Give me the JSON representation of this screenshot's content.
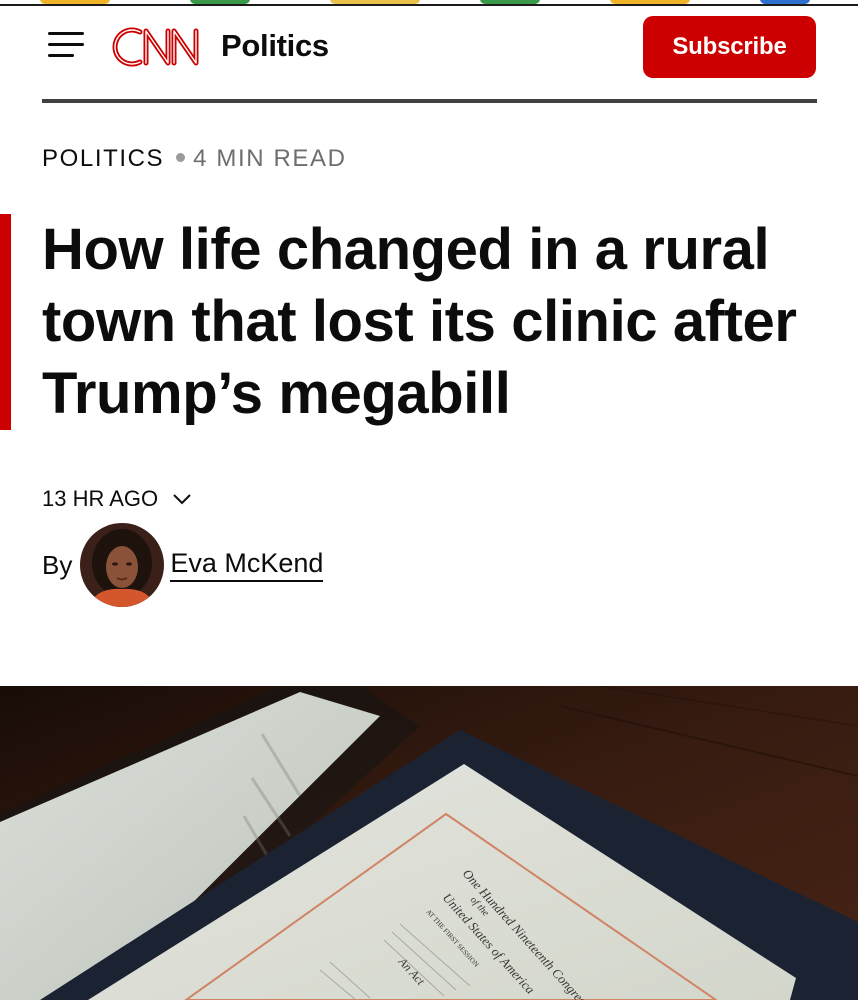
{
  "header": {
    "menu_icon": "hamburger-menu-icon",
    "logo_text": "CNN",
    "section": "Politics",
    "subscribe_label": "Subscribe"
  },
  "article": {
    "category": "POLITICS",
    "read_time": "4 MIN READ",
    "headline": "How life changed in a rural town that lost its clinic after Trump’s megabill",
    "timestamp": "13 HR AGO",
    "timestamp_icon": "chevron-down-icon",
    "byline_prefix": "By",
    "author": "Eva McKend"
  },
  "hero_image": {
    "document_header": "One Hundred Nineteenth Congress",
    "document_subheader": "of the",
    "document_country": "United States of America",
    "document_session": "AT THE FIRST SESSION",
    "document_act": "An Act"
  },
  "colors": {
    "brand_red": "#cc0000",
    "text": "#0c0c0c",
    "muted": "#6e6e6e",
    "rule": "#404040"
  }
}
